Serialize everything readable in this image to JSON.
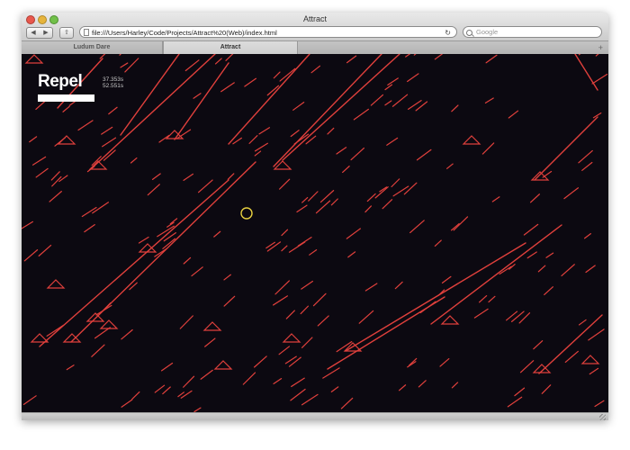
{
  "window": {
    "title": "Attract"
  },
  "toolbar": {
    "back_label": "◀",
    "forward_label": "▶",
    "action_label": "⇧",
    "url": "file:///Users/Harley/Code/Projects/Attract%20(Web)/index.html",
    "reload_label": "↻",
    "search_placeholder": "Google"
  },
  "tabs": [
    {
      "label": "Ludum Dare"
    },
    {
      "label": "Attract"
    }
  ],
  "newtab_label": "+",
  "game": {
    "title": "Repel",
    "stat1": "37.353s",
    "stat2": "52.551s"
  },
  "colors": {
    "background": "#0c0911",
    "lines": "#e0403c",
    "cursor": "#e8d040",
    "text": "#ffffff"
  }
}
